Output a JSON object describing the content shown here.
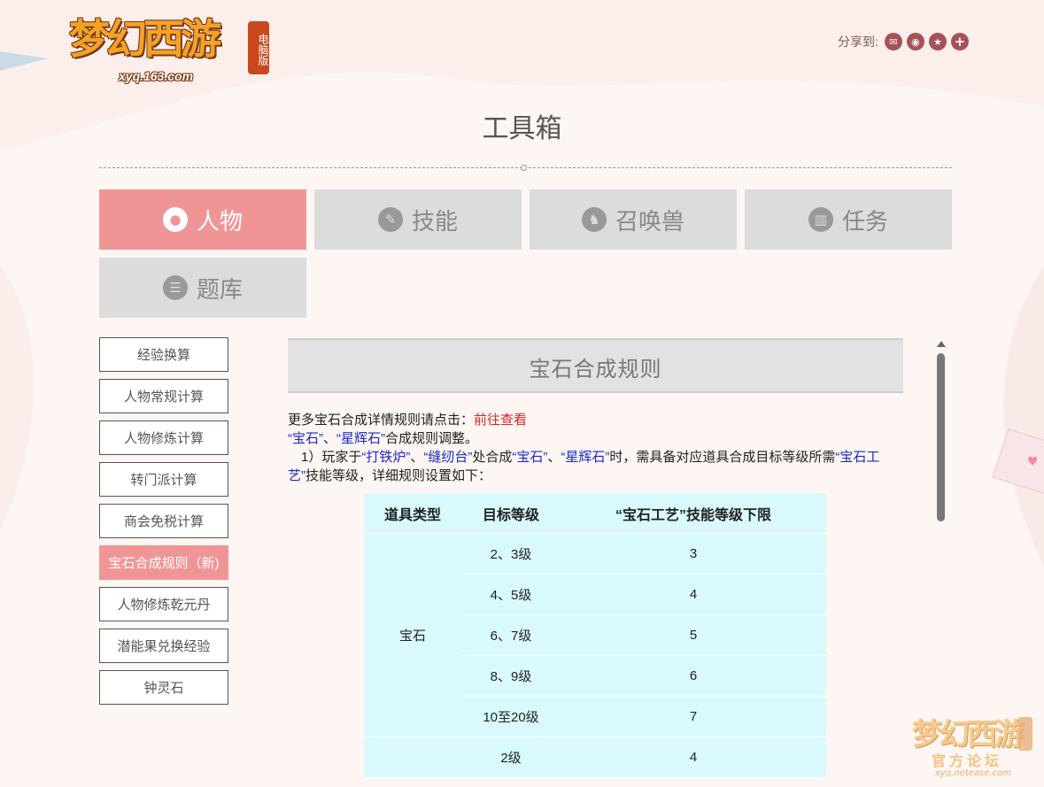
{
  "logo": {
    "name": "梦幻西游",
    "edition": "电脑版",
    "url": "xyq.163.com"
  },
  "share": {
    "label": "分享到:",
    "icons": [
      "wechat-icon",
      "weibo-icon",
      "star-icon",
      "plus-icon"
    ]
  },
  "page_title": "工具箱",
  "categories": [
    {
      "label": "人物",
      "icon": "person-icon",
      "active": true
    },
    {
      "label": "技能",
      "icon": "feather-icon",
      "active": false
    },
    {
      "label": "召唤兽",
      "icon": "beast-icon",
      "active": false
    },
    {
      "label": "任务",
      "icon": "book-icon",
      "active": false
    },
    {
      "label": "题库",
      "icon": "list-icon",
      "active": false
    }
  ],
  "sidebar": {
    "items": [
      {
        "label": "经验换算",
        "active": false
      },
      {
        "label": "人物常规计算",
        "active": false
      },
      {
        "label": "人物修炼计算",
        "active": false
      },
      {
        "label": "转门派计算",
        "active": false
      },
      {
        "label": "商会免税计算",
        "active": false
      },
      {
        "label": "宝石合成规则（新)",
        "active": true
      },
      {
        "label": "人物修炼乾元丹",
        "active": false
      },
      {
        "label": "潜能果兑换经验",
        "active": false
      },
      {
        "label": "钟灵石",
        "active": false
      }
    ]
  },
  "content": {
    "header": "宝石合成规则",
    "line1_prefix": "更多宝石合成详情规则请点击：",
    "line1_link": "前往查看",
    "line2": {
      "q1": "“宝石”",
      "sep": "、",
      "q2": "“星辉石”",
      "suffix": "合成规则调整。"
    },
    "line3": {
      "p1": "　1）玩家于",
      "k1": "“打铁炉”",
      "p2": "、",
      "k2": "“缝纫台”",
      "p3": "处合成",
      "k3": "“宝石”",
      "p4": "、",
      "k4": "“星辉石”",
      "p5": "时，需具备对应道具合成目标等级所需",
      "k5": "“宝石工艺”",
      "p6": "技能等级，详细规则设置如下："
    },
    "table": {
      "headers": [
        "道具类型",
        "目标等级",
        "“宝石工艺”技能等级下限"
      ],
      "group_label": "宝石",
      "rows": [
        {
          "level": "2、3级",
          "skill": "3"
        },
        {
          "level": "4、5级",
          "skill": "4"
        },
        {
          "level": "6、7级",
          "skill": "5"
        },
        {
          "level": "8、9级",
          "skill": "6"
        },
        {
          "level": "10至20级",
          "skill": "7"
        },
        {
          "level": "2级",
          "skill": "4"
        }
      ]
    }
  },
  "corner_logo": {
    "name": "梦幻西游",
    "sub": "官方论坛",
    "url": "xyq.netease.com"
  },
  "colors": {
    "accent": "#f09596",
    "tab_inactive": "#dcdcdc",
    "table_bg": "#d8fafd",
    "link_blue": "#1b28c8",
    "link_red": "#d4281f"
  }
}
